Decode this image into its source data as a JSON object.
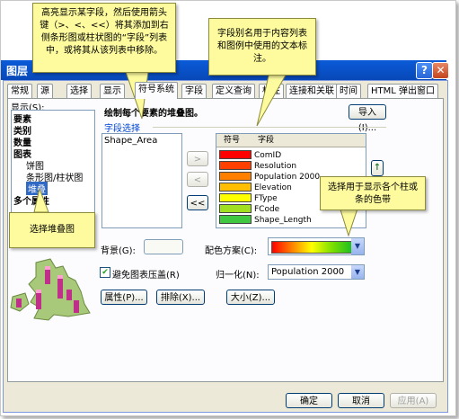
{
  "window": {
    "title": "图层",
    "help_label": "?",
    "close_label": "✕"
  },
  "tabs": [
    "常规",
    "源",
    "选择",
    "显示",
    "符号系统",
    "字段",
    "定义查询",
    "标注",
    "连接和关联",
    "时间",
    "HTML 弹出窗口"
  ],
  "active_tab": "符号系统",
  "show_label": "显示(S):",
  "tree": [
    {
      "label": "要素",
      "bold": true
    },
    {
      "label": "类别",
      "bold": true
    },
    {
      "label": "数量",
      "bold": true
    },
    {
      "label": "图表",
      "bold": true
    },
    {
      "label": "饼图",
      "bold": false
    },
    {
      "label": "条形图/柱状图",
      "bold": false
    },
    {
      "label": "堆叠",
      "bold": false,
      "selected": true
    },
    {
      "label": "多个属性",
      "bold": true
    }
  ],
  "heading": "绘制每个要素的堆叠图。",
  "import_button": "导入(I)...",
  "field_selection_label": "字段选择",
  "available_fields": [
    "Shape_Area"
  ],
  "move_right_label": ">",
  "move_left_label": "<",
  "move_all_left_label": "<<",
  "columns": {
    "symbol": "符号",
    "field": "字段"
  },
  "fields": [
    {
      "name": "ComID",
      "color": "#ff0000"
    },
    {
      "name": "Resolution",
      "color": "#ff4000"
    },
    {
      "name": "Population 2000",
      "color": "#ff8000"
    },
    {
      "name": "Elevation",
      "color": "#ffbf00"
    },
    {
      "name": "FType",
      "color": "#ffff00"
    },
    {
      "name": "FCode",
      "color": "#a0e020"
    },
    {
      "name": "Shape_Length",
      "color": "#40c840"
    }
  ],
  "move_up_label": "↑",
  "background_label": "背景(G):",
  "color_scheme_label": "配色方案(C):",
  "avoid_overlap_label": "避免图表压盖(R)",
  "normalize_label": "归一化(N):",
  "normalize_value": "Population 2000",
  "properties_button": "属性(P)...",
  "exclude_button": "排除(X)...",
  "size_button": "大小(Z)...",
  "ok_button": "确定",
  "cancel_button": "取消",
  "apply_button": "应用(A)",
  "callouts": {
    "top_left": "高亮显示某字段，然后使用箭头键（>、<、<<）将其添加到右侧条形图或柱状图的“字段”列表中，或将其从该列表中移除。",
    "top_right": "字段别名用于内容列表和图例中使用的文本标注。",
    "right": "选择用于显示各个柱或条的色带",
    "left": "选择堆叠图"
  },
  "colors": {
    "accent": "#0a5bd8",
    "callout": "#fdfb9e"
  }
}
